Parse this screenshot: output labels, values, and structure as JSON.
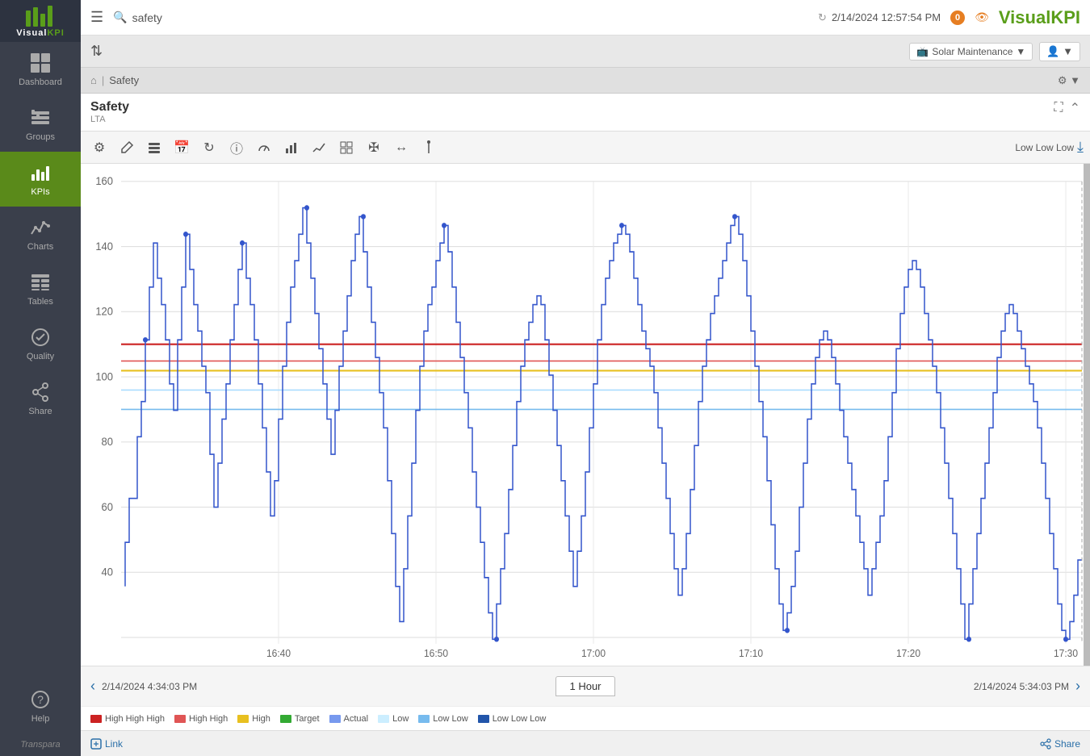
{
  "topbar": {
    "search_placeholder": "safety",
    "refresh_time": "2/14/2024 12:57:54 PM",
    "alert_count": "0",
    "logo_text": "Visual",
    "logo_accent": "KPI"
  },
  "secondbar": {
    "site": "Solar Maintenance",
    "monitor_icon": "🖥"
  },
  "breadcrumb": {
    "home_icon": "⌂",
    "separator": "|",
    "current": "Safety"
  },
  "kpi": {
    "title": "Safety",
    "subtitle": "LTA",
    "status": "Low Low Low"
  },
  "toolbar": {
    "icons": [
      "⚙",
      "✏",
      "☰",
      "📅",
      "↺",
      "ℹ",
      "◉",
      "📊",
      "↗",
      "⊞",
      "✛",
      "↔",
      "♦"
    ]
  },
  "chart": {
    "y_labels": [
      "160",
      "140",
      "120",
      "100",
      "80",
      "60",
      "40"
    ],
    "x_labels": [
      "16:40",
      "16:50",
      "17:00",
      "17:10",
      "17:20",
      "17:30"
    ],
    "time_start": "2/14/2024 4:34:03 PM",
    "time_end": "2/14/2024 5:34:03 PM",
    "time_range": "1 Hour",
    "high_high_high_color": "#cc2222",
    "high_high_color": "#e05555",
    "high_color": "#e8c020",
    "target_color": "#33aa33",
    "actual_color": "#5555cc",
    "low_color": "#aaddff",
    "low_low_color": "#55aaee",
    "low_low_low_color": "#2255aa",
    "line_y_red": 110,
    "line_y_yellow": 102,
    "line_y_lightblue1": 95,
    "line_y_lightblue2": 90
  },
  "legend": {
    "items": [
      {
        "label": "High High High",
        "color": "#cc2222"
      },
      {
        "label": "High High",
        "color": "#e05555"
      },
      {
        "label": "High",
        "color": "#e8c020"
      },
      {
        "label": "Target",
        "color": "#33aa33"
      },
      {
        "label": "Actual",
        "color": "#7799ee"
      },
      {
        "label": "Low",
        "color": "#cceeff"
      },
      {
        "label": "Low Low",
        "color": "#77bbee"
      },
      {
        "label": "Low Low Low",
        "color": "#2255aa"
      }
    ]
  },
  "footer": {
    "link_label": "Link",
    "share_label": "Share"
  },
  "sidebar": {
    "items": [
      {
        "label": "Dashboard",
        "icon": "dashboard"
      },
      {
        "label": "Groups",
        "icon": "groups"
      },
      {
        "label": "KPIs",
        "icon": "kpis",
        "active": true
      },
      {
        "label": "Charts",
        "icon": "charts"
      },
      {
        "label": "Tables",
        "icon": "tables"
      },
      {
        "label": "Quality",
        "icon": "quality"
      },
      {
        "label": "Share",
        "icon": "share"
      },
      {
        "label": "Help",
        "icon": "help"
      }
    ]
  }
}
